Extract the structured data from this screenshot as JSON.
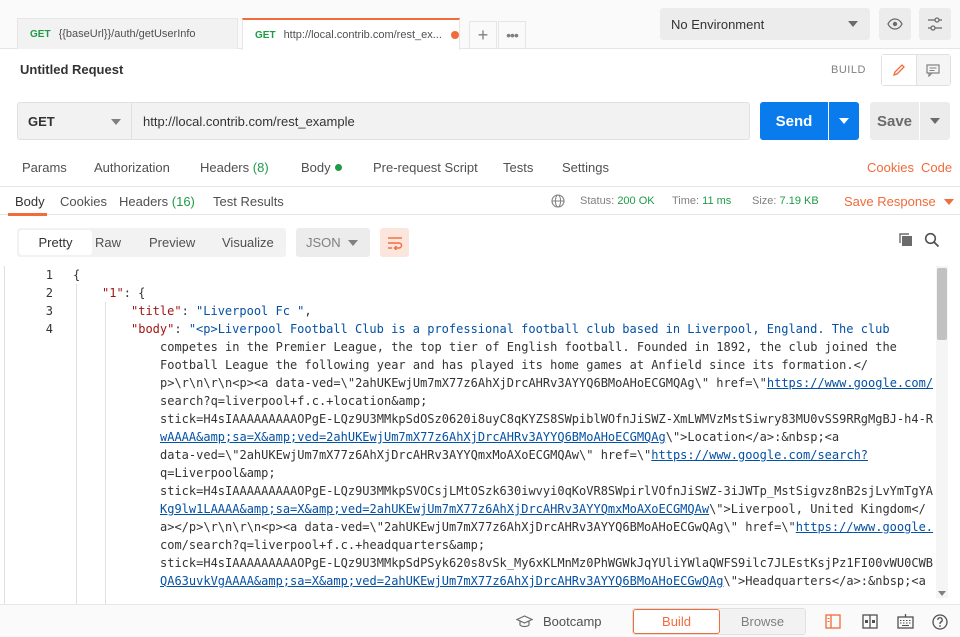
{
  "tabs": [
    {
      "method": "GET",
      "url": "{{baseUrl}}/auth/getUserInfo"
    },
    {
      "method": "GET",
      "url": "http://local.contrib.com/rest_ex..."
    }
  ],
  "environment": {
    "selected": "No Environment"
  },
  "request": {
    "title": "Untitled Request",
    "build_label": "BUILD",
    "method": "GET",
    "url": "http://local.contrib.com/rest_example",
    "send_label": "Send",
    "save_label": "Save"
  },
  "request_tabs": {
    "params": "Params",
    "authorization": "Authorization",
    "headers": "Headers",
    "headers_count": "(8)",
    "body": "Body",
    "prerequest": "Pre-request Script",
    "tests": "Tests",
    "settings": "Settings",
    "cookies": "Cookies",
    "code": "Code"
  },
  "response": {
    "tabs": {
      "body": "Body",
      "cookies": "Cookies",
      "headers": "Headers",
      "headers_count": "(16)",
      "test_results": "Test Results"
    },
    "status_label": "Status:",
    "status_value": "200 OK",
    "time_label": "Time:",
    "time_value": "11 ms",
    "size_label": "Size:",
    "size_value": "7.19 KB",
    "save_response": "Save Response"
  },
  "viewer": {
    "modes": [
      "Pretty",
      "Raw",
      "Preview",
      "Visualize"
    ],
    "active_mode": "Pretty",
    "format": "JSON"
  },
  "code": {
    "line_numbers": [
      "1",
      "2",
      "3",
      "4"
    ],
    "brace_open": "{",
    "key1": "\"1\"",
    "key1_suffix": ": {",
    "title_key": "\"title\"",
    "title_value": "\"Liverpool Fc \"",
    "body_key": "\"body\"",
    "body_lines": [
      "\"<p>Liverpool Football Club is a professional football club based in Liverpool, England. The club",
      "competes in the Premier League, the top tier of English football. Founded in 1892, the club joined the",
      "Football League the following year and has played its home games at Anfield since its formation.</",
      "p>\\r\\n\\r\\n<p><a data-ved=\\\"2ahUKEwjUm7mX77z6AhXjDrcAHRv3AYYQ6BMoAHoECGMQAg\\\" href=\\\"",
      "search?q=liverpool+f.c.+location&amp;",
      "stick=H4sIAAAAAAAAAOPgE-LQz9U3MMkpSdOSz0620i8uyC8qKYZS8SWpiblWOfnJiSWZ-XmLWMVzMstSiwry83MU0vSS9RRgMgBJ-h4-R",
      "wAAAA&amp;sa=X&amp;ved=2ahUKEwjUm7mX77z6AhXjDrcAHRv3AYYQ6BMoAHoECGMQAg",
      "data-ved=\\\"2ahUKEwjUm7mX77z6AhXjDrcAHRv3AYYQmxMoAXoECGMQAw\\\" href=\\\"",
      "q=Liverpool&amp;",
      "stick=H4sIAAAAAAAAAOPgE-LQz9U3MMkpSVOCsjLMtOSzk630iwvyi0qKoVR8SWpirlVOfnJiSWZ-3iJWTp_MstSigvz8nB2sjLvYmTgYA",
      "Kg9lw1LAAAA&amp;sa=X&amp;ved=2ahUKEwjUm7mX77z6AhXjDrcAHRv3AYYQmxMoAXoECGMQAw",
      "a></p>\\r\\n\\r\\n<p><a data-ved=\\\"2ahUKEwjUm7mX77z6AhXjDrcAHRv3AYYQ6BMoAHoECGwQAg\\\" href=\\\"",
      "com/search?q=liverpool+f.c.+headquarters&amp;",
      "stick=H4sIAAAAAAAAAOPgE-LQz9U3MMkpSdPSyk620s8vSk_My6xKLMnMz0PhWGWkJqYUliYWlaQWFS9ilc7JLEstKsjPz1FI00vWU0CWB",
      "QA63uvkVgAAAA&amp;sa=X&amp;ved=2ahUKEwjUm7mX77z6AhXjDrcAHRv3AYYQ6BMoAHoECGwQAg"
    ],
    "link1_start": "https://www.google.com/",
    "location_tail": "\\\">Location</",
    "location_tail2": "a>:&nbsp;<a",
    "link2_start": "https://www.google.com/search?",
    "liverpool_tail": "\\\">Liverpool, United Kingdom</",
    "link3_start": "https://www.google.",
    "hq_tail": "\\\">Headquarters</",
    "hq_tail2": "a>:&nbsp;<a"
  },
  "statusbar": {
    "bootcamp": "Bootcamp",
    "build": "Build",
    "browse": "Browse"
  },
  "colors": {
    "accent": "#f26b3a",
    "send": "#097bed",
    "success": "#1f9b47"
  }
}
